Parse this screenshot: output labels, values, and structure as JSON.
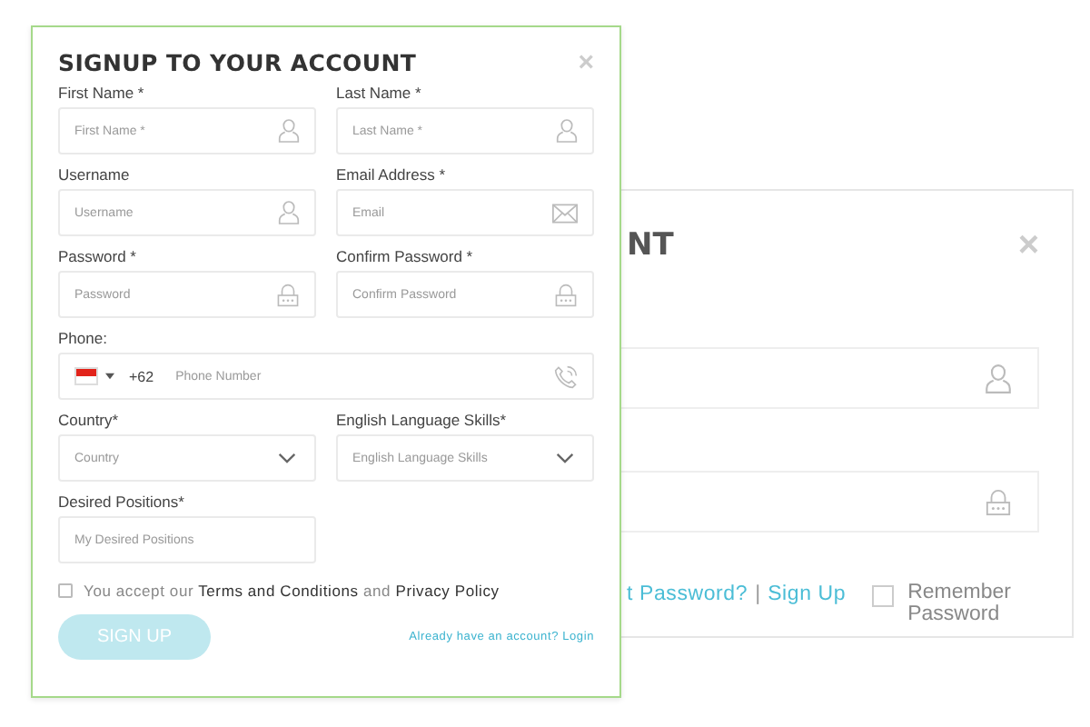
{
  "back_dialog": {
    "title": "NT",
    "close": "×",
    "links": [
      {
        "kind": "link",
        "text": "t Password?"
      },
      {
        "kind": "separator",
        "text": "|"
      },
      {
        "kind": "link",
        "text": "Sign Up"
      }
    ],
    "remember": {
      "label": "Remember Password",
      "checked": false
    }
  },
  "signup_dialog": {
    "title": "SIGNUP TO YOUR ACCOUNT",
    "close": "×",
    "fields": [
      {
        "kind": "text",
        "label": "First Name *",
        "placeholder": "First Name *"
      },
      {
        "kind": "text",
        "label": "Last Name *",
        "placeholder": "Last Name *"
      },
      {
        "kind": "text",
        "label": "Username",
        "placeholder": "Username"
      },
      {
        "kind": "text",
        "label": "Email Address *",
        "placeholder": "Email"
      },
      {
        "kind": "text",
        "label": "Password *",
        "placeholder": "Password"
      },
      {
        "kind": "text",
        "label": "Confirm Password *",
        "placeholder": "Confirm Password"
      },
      {
        "kind": "phone",
        "label": "Phone:",
        "country_code": "+62",
        "placeholder": "Phone Number"
      },
      {
        "kind": "select",
        "label": "Country*",
        "placeholder": "Country"
      },
      {
        "kind": "select",
        "label": "English Language Skills*",
        "placeholder": "English Language Skills"
      },
      {
        "kind": "text",
        "label": "Desired Positions*",
        "placeholder": "My Desired Positions"
      }
    ],
    "terms": {
      "text": "You accept our **Terms and Conditions** and **Privacy Policy**",
      "checked": false
    },
    "submit": "SIGN UP",
    "login_link": "Already have an account? Login"
  }
}
